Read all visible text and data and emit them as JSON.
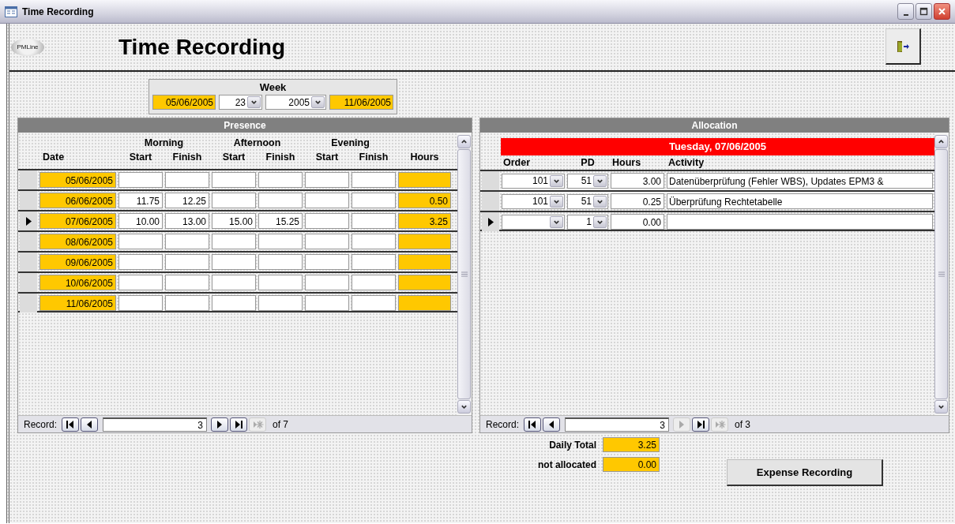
{
  "window": {
    "title": "Time Recording"
  },
  "header": {
    "logo_text": "PMLine",
    "title": "Time Recording"
  },
  "week": {
    "label": "Week",
    "start_date": "05/06/2005",
    "week_number": "23",
    "year": "2005",
    "end_date": "11/06/2005"
  },
  "presence": {
    "title": "Presence",
    "groups": [
      "Morning",
      "Afternoon",
      "Evening"
    ],
    "columns": [
      {
        "label": "Date",
        "kind": "date"
      },
      {
        "label": "Start",
        "kind": "time"
      },
      {
        "label": "Finish",
        "kind": "time"
      },
      {
        "label": "Start",
        "kind": "time"
      },
      {
        "label": "Finish",
        "kind": "time"
      },
      {
        "label": "Start",
        "kind": "time"
      },
      {
        "label": "Finish",
        "kind": "time"
      },
      {
        "label": "Hours",
        "kind": "total"
      }
    ],
    "rows": [
      {
        "selected": false,
        "cells": [
          "05/06/2005",
          null,
          null,
          null,
          null,
          null,
          null,
          null
        ]
      },
      {
        "selected": false,
        "cells": [
          "06/06/2005",
          "11.75",
          "12.25",
          null,
          null,
          null,
          null,
          "0.50"
        ]
      },
      {
        "selected": true,
        "cells": [
          "07/06/2005",
          "10.00",
          "13.00",
          "15.00",
          "15.25",
          null,
          null,
          "3.25"
        ]
      },
      {
        "selected": false,
        "cells": [
          "08/06/2005",
          null,
          null,
          null,
          null,
          null,
          null,
          null
        ]
      },
      {
        "selected": false,
        "cells": [
          "09/06/2005",
          null,
          null,
          null,
          null,
          null,
          null,
          null
        ]
      },
      {
        "selected": false,
        "cells": [
          "10/06/2005",
          null,
          null,
          null,
          null,
          null,
          null,
          null
        ]
      },
      {
        "selected": false,
        "cells": [
          "11/06/2005",
          null,
          null,
          null,
          null,
          null,
          null,
          null
        ]
      }
    ],
    "navigator": {
      "label": "Record:",
      "current": "3",
      "total": "of 7",
      "buttons": [
        {
          "kind": "first",
          "disabled": false
        },
        {
          "kind": "prev",
          "disabled": false
        },
        {
          "kind": "next",
          "disabled": false
        },
        {
          "kind": "last",
          "disabled": false
        },
        {
          "kind": "new",
          "disabled": true
        }
      ]
    }
  },
  "allocation": {
    "title": "Allocation",
    "day": "Tuesday, 07/06/2005",
    "columns": [
      "Order",
      "PD",
      "Hours",
      "Activity"
    ],
    "rows": [
      {
        "selected": false,
        "order": "101",
        "pd": "51",
        "hours": "3.00",
        "activity": "Datenüberprüfung (Fehler WBS), Updates EPM3 &"
      },
      {
        "selected": false,
        "order": "101",
        "pd": "51",
        "hours": "0.25",
        "activity": "Überprüfung Rechtetabelle"
      },
      {
        "selected": true,
        "pd": "1",
        "hours": "0.00"
      }
    ],
    "navigator": {
      "label": "Record:",
      "current": "3",
      "total": "of 3",
      "buttons": [
        {
          "kind": "first",
          "disabled": false
        },
        {
          "kind": "prev",
          "disabled": false
        },
        {
          "kind": "next",
          "disabled": true
        },
        {
          "kind": "last",
          "disabled": false
        },
        {
          "kind": "new",
          "disabled": true
        }
      ]
    }
  },
  "totals": [
    {
      "label": "Daily Total",
      "value": "3.25"
    },
    {
      "label": "not allocated",
      "value": "0.00"
    }
  ],
  "expense_button": "Expense Recording"
}
